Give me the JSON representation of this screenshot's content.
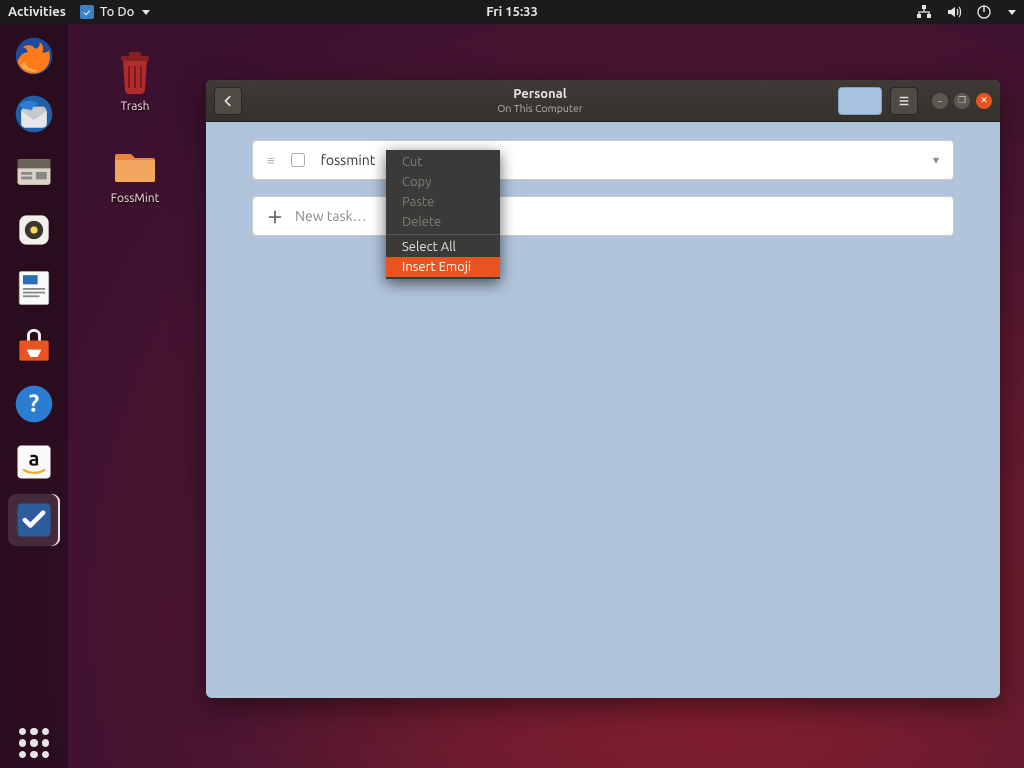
{
  "panel": {
    "activities": "Activities",
    "app_name": "To Do",
    "clock": "Fri 15:33"
  },
  "desktop": {
    "trash": "Trash",
    "folder": "FossMint"
  },
  "window": {
    "title": "Personal",
    "subtitle": "On This Computer",
    "task_text": "fossmint",
    "new_task_placeholder": "New task…"
  },
  "context_menu": {
    "cut": "Cut",
    "copy": "Copy",
    "paste": "Paste",
    "delete": "Delete",
    "select_all": "Select All",
    "insert_emoji": "Insert Emoji"
  }
}
